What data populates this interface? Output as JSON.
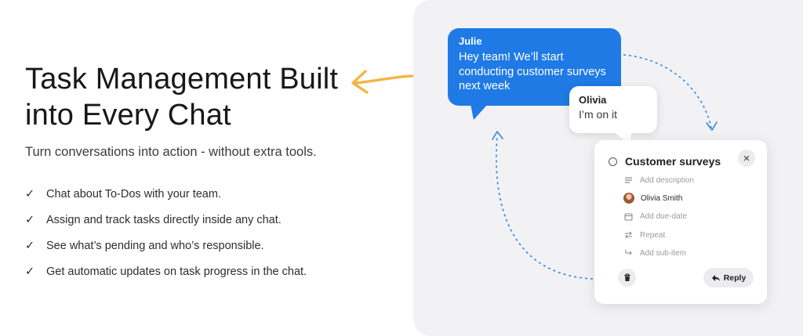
{
  "hero": {
    "title_line1": "Task Management Built",
    "title_line2": "into Every Chat",
    "subtitle": "Turn conversations into action - without extra tools.",
    "features": [
      "Chat about To-Dos with your team.",
      "Assign and track tasks directly inside any chat.",
      "See what’s pending and who’s responsible.",
      "Get automatic updates on task progress in the chat."
    ],
    "check_glyph": "✓"
  },
  "chat": {
    "julie": {
      "name": "Julie",
      "message": "Hey team! We’ll start conducting customer surveys next week"
    },
    "olivia": {
      "name": "Olivia",
      "message": "I’m on it"
    }
  },
  "task": {
    "title": "Customer surveys",
    "close_glyph": "✕",
    "description_placeholder": "Add description",
    "assignee": "Olivia Smith",
    "due_date_placeholder": "Add due-date",
    "repeat_label": "Repeat",
    "subitem_placeholder": "Add sub-item",
    "reply_label": "Reply"
  },
  "colors": {
    "accent": "#1f7ae6",
    "arrow": "#f6b443",
    "panel_bg": "#f2f2f4"
  },
  "icons": [
    "arrow-icon",
    "check-icon",
    "close-icon",
    "description-icon",
    "avatar",
    "calendar-icon",
    "repeat-icon",
    "subitem-icon",
    "trash-icon",
    "reply-icon"
  ]
}
